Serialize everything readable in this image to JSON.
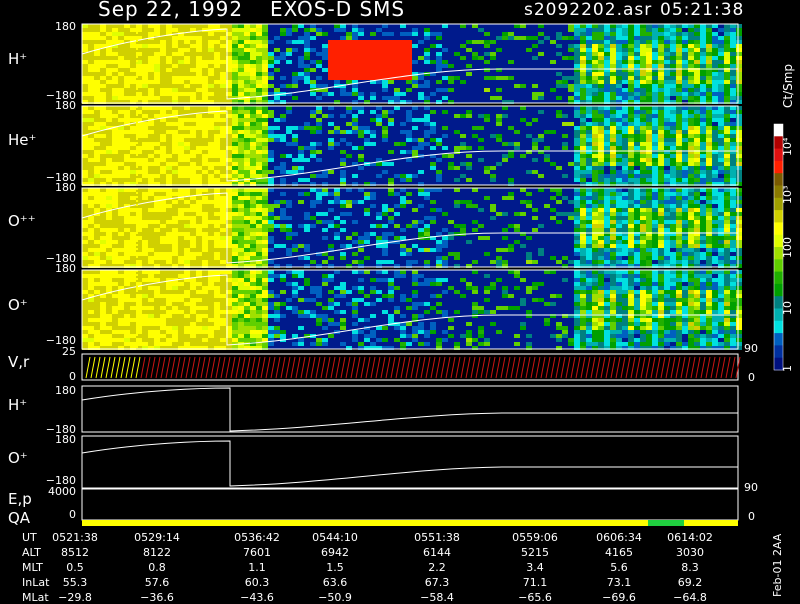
{
  "header": {
    "date": "Sep 22, 1992",
    "instrument": "EXOS-D SMS",
    "file": "s2092202.asr",
    "time": "05:21:38"
  },
  "colorbar": {
    "unit": "Ct/Smp",
    "tick_labels": [
      "10⁴",
      "10³",
      "100",
      "10",
      "1"
    ],
    "colors": [
      "#ffffff",
      "#b00000",
      "#e01010",
      "#ff2000",
      "#7a5a00",
      "#8a7a00",
      "#a0a000",
      "#d0d000",
      "#ffff00",
      "#e0ff00",
      "#a0e000",
      "#60d000",
      "#20b000",
      "#00a000",
      "#008080",
      "#00b0b0",
      "#00e0e0",
      "#0060c0",
      "#0030a0",
      "#001080"
    ]
  },
  "side_note": "Feb-01 2AA",
  "panels": {
    "hplus": {
      "label": "H⁺",
      "top": "180",
      "bottom": "−180"
    },
    "heplus": {
      "label": "He⁺",
      "top": "180",
      "bottom": "−180"
    },
    "oplusplus": {
      "label": "O⁺⁺",
      "top": "180",
      "bottom": "−180"
    },
    "oplus": {
      "label": "O⁺",
      "top": "180",
      "bottom": "−180"
    },
    "vr": {
      "label": "V,r",
      "top": "25",
      "bottom": "0",
      "right_top": "90",
      "right_bottom": "0"
    },
    "hplus_line": {
      "label": "H⁺",
      "top": "180",
      "bottom": "−180"
    },
    "oplus_line": {
      "label": "O⁺",
      "top": "180",
      "bottom": "−180"
    },
    "ep": {
      "label": "E,p",
      "top": "4000",
      "right_top": "90"
    },
    "qa": {
      "label": "QA",
      "bottom": "0",
      "right_bottom": "0"
    }
  },
  "table": {
    "labels": [
      "UT",
      "ALT",
      "MLT",
      "InLat",
      "MLat"
    ],
    "columns": [
      [
        "0521:38",
        "8512",
        "0.5",
        "55.3",
        "−29.8"
      ],
      [
        "0529:14",
        "8122",
        "0.8",
        "57.6",
        "−36.6"
      ],
      [
        "0536:42",
        "7601",
        "1.1",
        "60.3",
        "−43.6"
      ],
      [
        "0544:10",
        "6942",
        "1.5",
        "63.6",
        "−50.9"
      ],
      [
        "0551:38",
        "6144",
        "2.2",
        "67.3",
        "−58.4"
      ],
      [
        "0559:06",
        "5215",
        "3.4",
        "71.1",
        "−65.6"
      ],
      [
        "0606:34",
        "4165",
        "5.6",
        "73.1",
        "−69.6"
      ],
      [
        "0614:02",
        "3030",
        "8.3",
        "69.2",
        "−64.8"
      ]
    ]
  },
  "chart_data": {
    "type": "heatmap",
    "title": "Sep 22, 1992  EXOS-D SMS",
    "x": [
      "0521:38",
      "0529:14",
      "0536:42",
      "0544:10",
      "0551:38",
      "0559:06",
      "0606:34",
      "0614:02"
    ],
    "species": [
      "H⁺",
      "He⁺",
      "O⁺⁺",
      "O⁺"
    ],
    "ylim": [
      -180,
      180
    ],
    "color_unit": "Ct/Smp",
    "color_scale": "log",
    "color_range": [
      1,
      10000
    ]
  }
}
